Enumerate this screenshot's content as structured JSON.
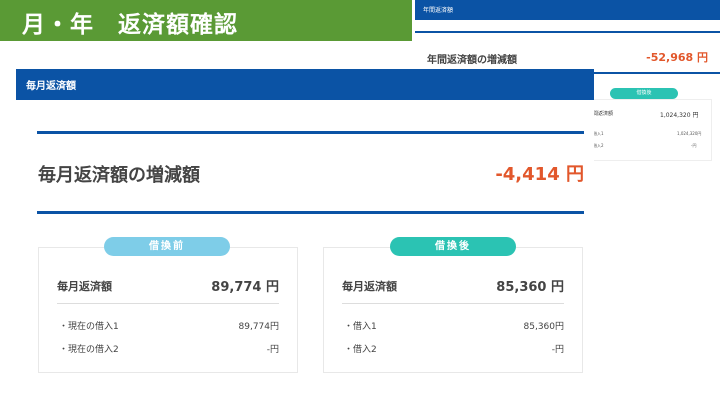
{
  "slide": {
    "title": "月・年　返済額確認"
  },
  "annual": {
    "header": "年間返済額",
    "diff_label": "年間返済額の増減額",
    "diff_value": "-52,968 円",
    "after_pill": "借換後",
    "row_label": "間返済額",
    "row_value": "1,024,320 円",
    "sub1_label": "借入1",
    "sub1_value": "1,024,320円",
    "sub2_label": "借入2",
    "sub2_value": "-円"
  },
  "monthly": {
    "header": "毎月返済額",
    "diff_label": "毎月返済額の増減額",
    "diff_value": "-4,414 円",
    "before": {
      "pill": "借換前",
      "label": "毎月返済額",
      "value": "89,774 円",
      "items": [
        {
          "label": "・現在の借入1",
          "value": "89,774円"
        },
        {
          "label": "・現在の借入2",
          "value": "-円"
        }
      ]
    },
    "after": {
      "pill": "借換後",
      "label": "毎月返済額",
      "value": "85,360 円",
      "items": [
        {
          "label": "・借入1",
          "value": "85,360円"
        },
        {
          "label": "・借入2",
          "value": "-円"
        }
      ]
    }
  },
  "colors": {
    "title_bg": "#5a9a35",
    "header_blue": "#0b53a5",
    "decrease_orange": "#e2572b",
    "before_pill": "#7ecde8",
    "after_pill": "#2bc3b3"
  }
}
